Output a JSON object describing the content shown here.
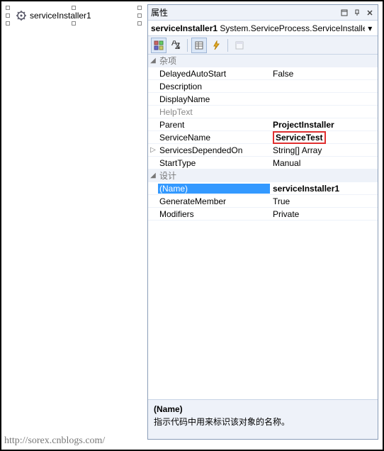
{
  "designer": {
    "component_label": "serviceInstaller1"
  },
  "panel": {
    "title": "属性",
    "object_name": "serviceInstaller1",
    "object_type": "System.ServiceProcess.ServiceInstaller",
    "cat_misc": "杂项",
    "cat_design": "设计",
    "props_misc": [
      {
        "name": "DelayedAutoStart",
        "value": "False"
      },
      {
        "name": "Description",
        "value": ""
      },
      {
        "name": "DisplayName",
        "value": ""
      },
      {
        "name": "HelpText",
        "value": "",
        "readonly": true
      },
      {
        "name": "Parent",
        "value": "ProjectInstaller",
        "bold": true
      },
      {
        "name": "ServiceName",
        "value": "ServiceTest",
        "bold": true,
        "highlight": true
      },
      {
        "name": "ServicesDependedOn",
        "value": "String[] Array",
        "expandable": true
      },
      {
        "name": "StartType",
        "value": "Manual"
      }
    ],
    "props_design": [
      {
        "name": "(Name)",
        "value": "serviceInstaller1",
        "selected": true,
        "bold": true
      },
      {
        "name": "GenerateMember",
        "value": "True"
      },
      {
        "name": "Modifiers",
        "value": "Private"
      }
    ],
    "desc_name": "(Name)",
    "desc_text": "指示代码中用来标识该对象的名称。"
  },
  "watermark": "http://sorex.cnblogs.com/"
}
